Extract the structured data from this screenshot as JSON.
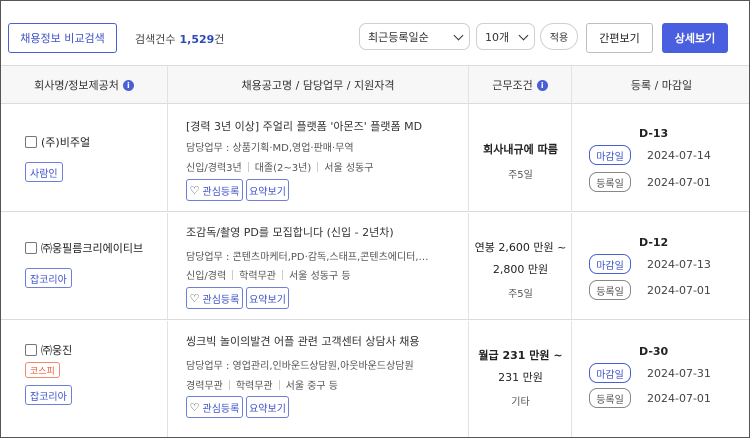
{
  "toolbar": {
    "compare_label": "채용정보 비교검색",
    "count_label": "검색건수",
    "count_value": "1,529",
    "count_unit": "건",
    "sort_selected": "최근등록일순",
    "page_size_selected": "10개",
    "apply_label": "적용",
    "simple_view_label": "간편보기",
    "detail_view_label": "상세보기"
  },
  "header": {
    "company": "회사명/정보제공처",
    "posting": "채용공고명 / 담당업무 / 지원자격",
    "conditions": "근무조건",
    "dates": "등록 / 마감일",
    "info_icon": "i"
  },
  "labels": {
    "favorite": "관심등록",
    "summary": "요약보기",
    "deadline": "마감일",
    "registered": "등록일",
    "heart_icon": "♡"
  },
  "jobs": [
    {
      "company": "(주)비주얼",
      "source": "사람인",
      "kospi": "",
      "title": "[경력 3년 이상] 주얼리 플랫폼 '아몬즈' 플랫폼 MD",
      "duty": "담당업무 : 상품기획·MD,영업·판매·무역",
      "cond": [
        "신입/경력3년",
        "대졸(2~3년)",
        "서울 성동구"
      ],
      "pay1": "회사내규에 따름",
      "pay2": "",
      "work": "주5일",
      "dday": "D-13",
      "deadline": "2024-07-14",
      "registered": "2024-07-01"
    },
    {
      "company": "㈜웅필름크리에이티브",
      "source": "잡코리아",
      "kospi": "",
      "title": "조감독/촬영 PD를 모집합니다 (신입 - 2년차)",
      "duty": "담당업무 : 콘텐츠마케터,PD·감독,스태프,콘텐츠에디터,…",
      "cond": [
        "신입/경력",
        "학력무관",
        "서울 성동구 등"
      ],
      "pay1": "연봉 2,600 만원 ~",
      "pay2": "2,800 만원",
      "work": "주5일",
      "dday": "D-12",
      "deadline": "2024-07-13",
      "registered": "2024-07-01"
    },
    {
      "company": "㈜웅진",
      "source": "잡코리아",
      "kospi": "코스피",
      "title": "씽크빅 놀이의발견 어플 관련 고객센터 상담사 채용",
      "duty": "담당업무 : 영업관리,인바운드상담원,아웃바운드상담원",
      "cond": [
        "경력무관",
        "학력무관",
        "서울 중구 등"
      ],
      "pay1": "월급 231 만원 ~",
      "pay2": "231 만원",
      "work": "기타",
      "dday": "D-30",
      "deadline": "2024-07-31",
      "registered": "2024-07-01"
    }
  ]
}
